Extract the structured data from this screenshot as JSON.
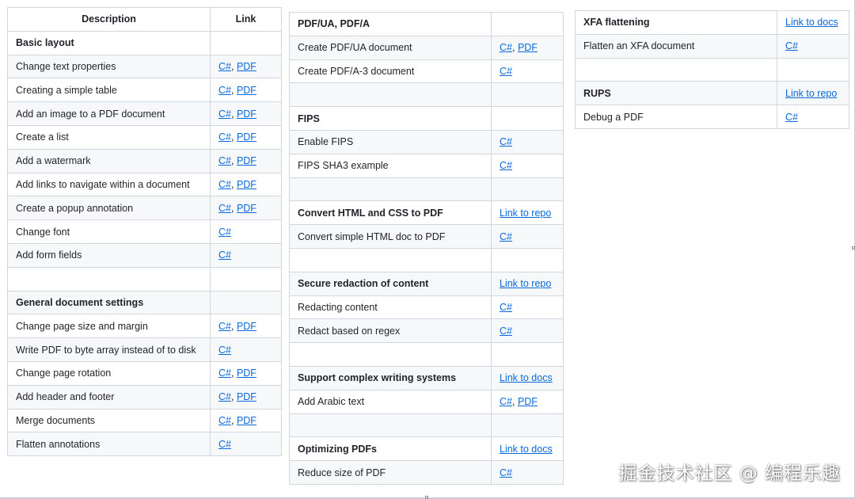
{
  "colors": {
    "link": "#0969da",
    "border": "#d0d7de",
    "alt_row": "#f6f8fa"
  },
  "table1": {
    "headers": [
      "Description",
      "Link"
    ],
    "rows": [
      {
        "type": "section",
        "label": "Basic layout",
        "links": []
      },
      {
        "type": "row",
        "label": "Change text properties",
        "links": [
          "C#",
          "PDF"
        ]
      },
      {
        "type": "row",
        "label": "Creating a simple table",
        "links": [
          "C#",
          "PDF"
        ]
      },
      {
        "type": "row",
        "label": "Add an image to a PDF document",
        "links": [
          "C#",
          "PDF"
        ]
      },
      {
        "type": "row",
        "label": "Create a list",
        "links": [
          "C#",
          "PDF"
        ]
      },
      {
        "type": "row",
        "label": "Add a watermark",
        "links": [
          "C#",
          "PDF"
        ]
      },
      {
        "type": "row",
        "label": "Add links to navigate within a document",
        "links": [
          "C#",
          "PDF"
        ]
      },
      {
        "type": "row",
        "label": "Create a popup annotation",
        "links": [
          "C#",
          "PDF"
        ]
      },
      {
        "type": "row",
        "label": "Change font",
        "links": [
          "C#"
        ]
      },
      {
        "type": "row",
        "label": "Add form fields",
        "links": [
          "C#"
        ]
      },
      {
        "type": "blank",
        "label": "",
        "links": []
      },
      {
        "type": "section",
        "label": "General document settings",
        "links": []
      },
      {
        "type": "row",
        "label": "Change page size and margin",
        "links": [
          "C#",
          "PDF"
        ]
      },
      {
        "type": "row",
        "label": "Write PDF to byte array instead of to disk",
        "links": [
          "C#"
        ]
      },
      {
        "type": "row",
        "label": "Change page rotation",
        "links": [
          "C#",
          "PDF"
        ]
      },
      {
        "type": "row",
        "label": "Add header and footer",
        "links": [
          "C#",
          "PDF"
        ]
      },
      {
        "type": "row",
        "label": "Merge documents",
        "links": [
          "C#",
          "PDF"
        ]
      },
      {
        "type": "row",
        "label": "Flatten annotations",
        "links": [
          "C#"
        ]
      }
    ]
  },
  "table2": {
    "rows": [
      {
        "type": "section",
        "label": "PDF/UA, PDF/A",
        "links": []
      },
      {
        "type": "row",
        "label": "Create PDF/UA document",
        "links": [
          "C#",
          "PDF"
        ]
      },
      {
        "type": "row",
        "label": "Create PDF/A-3 document",
        "links": [
          "C#"
        ]
      },
      {
        "type": "blank",
        "label": "",
        "links": []
      },
      {
        "type": "section",
        "label": "FIPS",
        "links": []
      },
      {
        "type": "row",
        "label": "Enable FIPS",
        "links": [
          "C#"
        ]
      },
      {
        "type": "row",
        "label": "FIPS SHA3 example",
        "links": [
          "C#"
        ]
      },
      {
        "type": "blank",
        "label": "",
        "links": []
      },
      {
        "type": "section",
        "label": "Convert HTML and CSS to PDF",
        "links": [
          "Link to repo"
        ]
      },
      {
        "type": "row",
        "label": "Convert simple HTML doc to PDF",
        "links": [
          "C#"
        ]
      },
      {
        "type": "blank",
        "label": "",
        "links": []
      },
      {
        "type": "section",
        "label": "Secure redaction of content",
        "links": [
          "Link to repo"
        ]
      },
      {
        "type": "row",
        "label": "Redacting content",
        "links": [
          "C#"
        ]
      },
      {
        "type": "row",
        "label": "Redact based on regex",
        "links": [
          "C#"
        ]
      },
      {
        "type": "blank",
        "label": "",
        "links": []
      },
      {
        "type": "section",
        "label": "Support complex writing systems",
        "links": [
          "Link to docs"
        ]
      },
      {
        "type": "row",
        "label": "Add Arabic text",
        "links": [
          "C#",
          "PDF"
        ]
      },
      {
        "type": "blank",
        "label": "",
        "links": []
      },
      {
        "type": "section",
        "label": "Optimizing PDFs",
        "links": [
          "Link to docs"
        ]
      },
      {
        "type": "row",
        "label": "Reduce size of PDF",
        "links": [
          "C#"
        ]
      }
    ]
  },
  "table3": {
    "rows": [
      {
        "type": "section",
        "label": "XFA flattening",
        "links": [
          "Link to docs"
        ]
      },
      {
        "type": "row",
        "label": "Flatten an XFA document",
        "links": [
          "C#"
        ]
      },
      {
        "type": "blank",
        "label": "",
        "links": []
      },
      {
        "type": "section",
        "label": "RUPS",
        "links": [
          "Link to repo"
        ]
      },
      {
        "type": "row",
        "label": "Debug a PDF",
        "links": [
          "C#"
        ]
      }
    ]
  },
  "watermark": "掘金技术社区 @ 编程乐趣"
}
